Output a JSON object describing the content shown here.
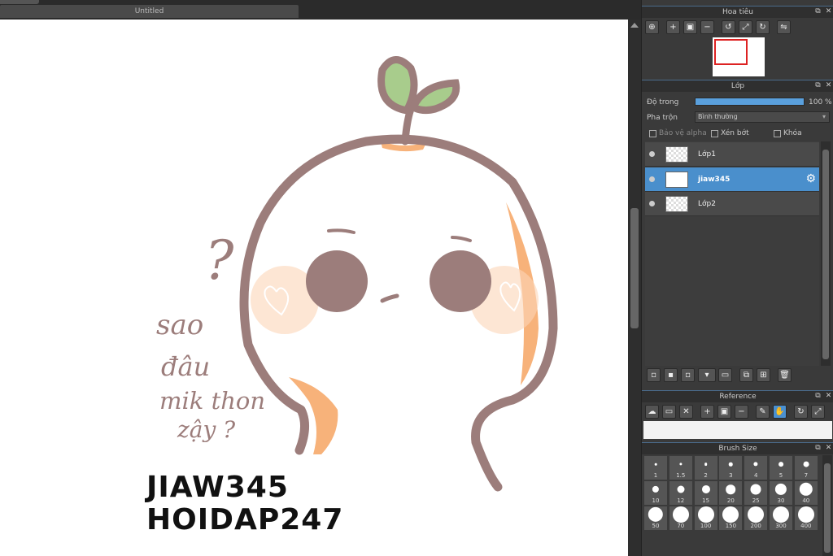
{
  "document_tab": "Untitled",
  "canvas": {
    "question_mark": "?",
    "handwriting": [
      "sao",
      "đâu",
      "mik thon",
      "zậy ?"
    ],
    "watermark_lines": [
      "JIAW345",
      "HOIDAP247"
    ]
  },
  "navigator": {
    "title": "Hoa tiêu"
  },
  "layer_panel": {
    "title": "Lớp",
    "opacity_label": "Độ trong",
    "opacity_value": "100 %",
    "opacity_fraction": 1.0,
    "blend_label": "Pha trộn",
    "blend_value": "Bình thường",
    "protect_alpha": "Bảo vệ alpha",
    "clipping": "Xén bớt",
    "lock": "Khóa",
    "layers": [
      {
        "name": "Lớp1",
        "selected": false
      },
      {
        "name": "jiaw345",
        "selected": true
      },
      {
        "name": "Lớp2",
        "selected": false
      }
    ]
  },
  "reference": {
    "title": "Reference"
  },
  "brush_size": {
    "title": "Brush Size",
    "sizes": [
      "1",
      "1.5",
      "2",
      "3",
      "4",
      "5",
      "7",
      "10",
      "12",
      "15",
      "20",
      "25",
      "30",
      "40",
      "50",
      "70",
      "100",
      "150",
      "200",
      "300",
      "400"
    ]
  },
  "colors": {
    "accent": "#4a8fcc",
    "outline": "#9c7d7b",
    "blush": "#f7b27a",
    "leaf": "#a8cc8c"
  }
}
